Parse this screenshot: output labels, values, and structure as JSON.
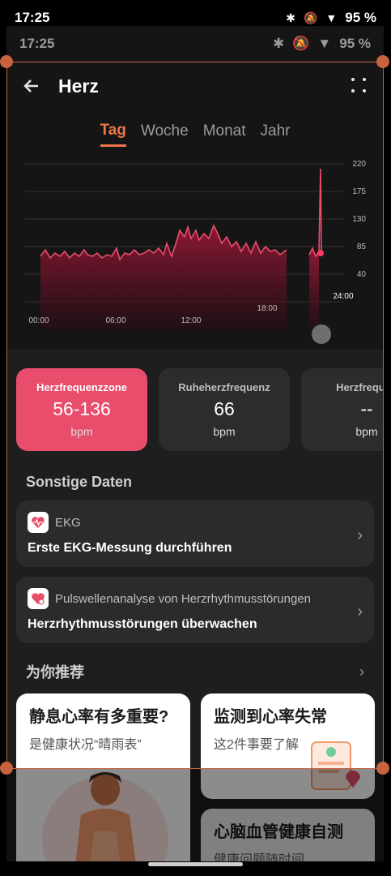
{
  "status_bar": {
    "time": "17:25",
    "battery": "95 %"
  },
  "inner_status_bar": {
    "time": "17:25",
    "battery": "95 %"
  },
  "header": {
    "title": "Herz"
  },
  "tabs": [
    {
      "label": "Tag"
    },
    {
      "label": "Woche"
    },
    {
      "label": "Monat"
    },
    {
      "label": "Jahr"
    }
  ],
  "chart_data": {
    "type": "area",
    "y_ticks": [
      "220",
      "175",
      "130",
      "85",
      "40"
    ],
    "x_ticks": [
      "00:00",
      "06:00",
      "12:00",
      "18:00",
      "24:00"
    ],
    "ylim": [
      40,
      220
    ],
    "series_color": "#e84d6c"
  },
  "metrics": [
    {
      "label": "Herzfrequenzzone",
      "value": "56-136",
      "unit": "bpm"
    },
    {
      "label": "Ruheherzfrequenz",
      "value": "66",
      "unit": "bpm"
    },
    {
      "label": "Herzfrequen",
      "value": "--",
      "unit": "bpm"
    }
  ],
  "other_data": {
    "title": "Sonstige Daten",
    "items": [
      {
        "top": "EKG",
        "bottom": "Erste EKG-Messung durchführen"
      },
      {
        "top": "Pulswellenanalyse von Herzrhythmusstörungen",
        "bottom": "Herzrhythmusstörungen überwachen"
      }
    ]
  },
  "recommend": {
    "title": "为你推荐",
    "cards": [
      {
        "title": "静息心率有多重要?",
        "subtitle": "是健康状况“晴雨表”"
      },
      {
        "title": "监测到心率失常",
        "subtitle": "这2件事要了解"
      },
      {
        "title": "心脑血管健康自测",
        "subtitle": "健康问题随时间"
      }
    ]
  },
  "colors": {
    "accent": "#f0754a",
    "active_card": "#e84d6c",
    "crop": "#c7643f"
  }
}
